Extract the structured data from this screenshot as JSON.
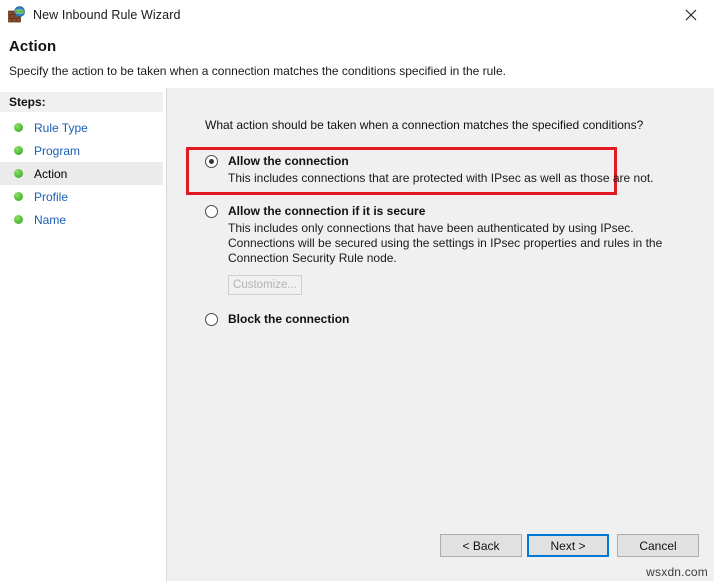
{
  "window": {
    "title": "New Inbound Rule Wizard",
    "icon": "firewall-globe-icon",
    "close_label": "✕"
  },
  "header": {
    "title": "Action",
    "subtitle": "Specify the action to be taken when a connection matches the conditions specified in the rule."
  },
  "sidebar": {
    "heading": "Steps:",
    "items": [
      {
        "label": "Rule Type",
        "current": false
      },
      {
        "label": "Program",
        "current": false
      },
      {
        "label": "Action",
        "current": true
      },
      {
        "label": "Profile",
        "current": false
      },
      {
        "label": "Name",
        "current": false
      }
    ]
  },
  "main": {
    "question": "What action should be taken when a connection matches the specified conditions?",
    "options": [
      {
        "label": "Allow the connection",
        "description": "This includes connections that are protected with IPsec as well as those are not.",
        "selected": true,
        "highlighted": true
      },
      {
        "label": "Allow the connection if it is secure",
        "description": "This includes only connections that have been authenticated by using IPsec.  Connections will be secured using the settings in IPsec properties and rules in the Connection Security Rule node.",
        "selected": false,
        "highlighted": false,
        "button": {
          "label": "Customize...",
          "enabled": false
        }
      },
      {
        "label": "Block the connection",
        "description": "",
        "selected": false,
        "highlighted": false
      }
    ]
  },
  "footer": {
    "back_label": "< Back",
    "next_label": "Next >",
    "cancel_label": "Cancel"
  },
  "watermark": "wsxdn.com",
  "colors": {
    "annotation": "#e01b22",
    "focus": "#0078d7",
    "link": "#1a5fb4",
    "panel": "#f0f0f0",
    "bullet": "#55bf3b"
  }
}
